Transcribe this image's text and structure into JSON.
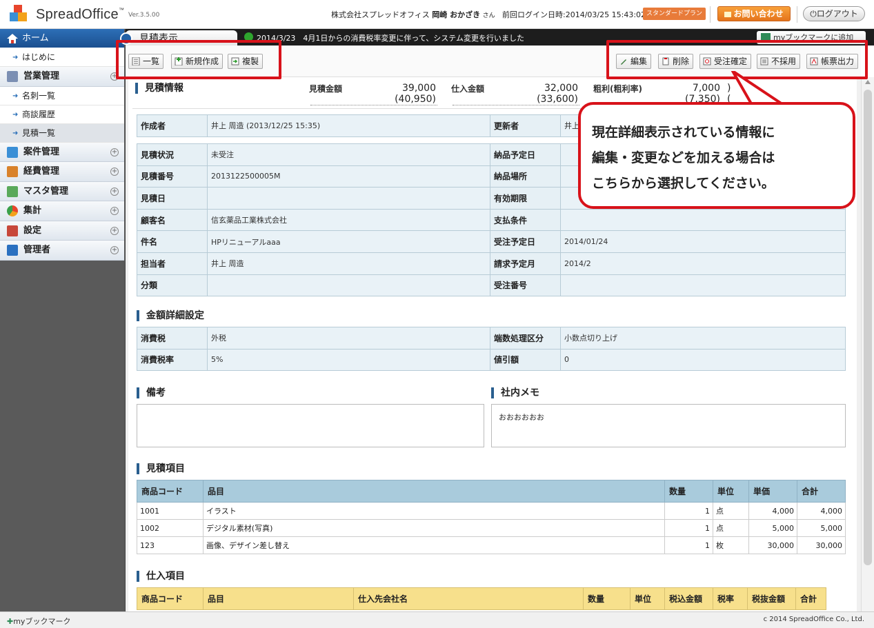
{
  "header": {
    "brand": "SpreadOffice",
    "trademark": "™",
    "version": "Ver.3.5.00",
    "company": "株式会社スプレッドオフィス",
    "user_name": "岡崎 おかざき",
    "honorific": "さん",
    "last_login_label": "前回ログイン日時:",
    "last_login_value": "2014/03/25 15:43:02",
    "plan_badge": "スタンダードプラン",
    "contact_button": "お問い合わせ",
    "logout_button": "ログアウト"
  },
  "sidebar": {
    "home": "ホーム",
    "items": [
      {
        "label": "はじめに",
        "type": "sub"
      },
      {
        "label": "営業管理",
        "type": "section",
        "icon": "sales-icon"
      },
      {
        "label": "名刺一覧",
        "type": "sub"
      },
      {
        "label": "商談履歴",
        "type": "sub"
      },
      {
        "label": "見積一覧",
        "type": "sub",
        "active": true
      },
      {
        "label": "案件管理",
        "type": "section",
        "icon": "project-icon"
      },
      {
        "label": "経費管理",
        "type": "section",
        "icon": "expense-icon"
      },
      {
        "label": "マスタ管理",
        "type": "section",
        "icon": "master-icon"
      },
      {
        "label": "集計",
        "type": "section",
        "icon": "chart-icon"
      },
      {
        "label": "設定",
        "type": "section",
        "icon": "settings-icon"
      },
      {
        "label": "管理者",
        "type": "section",
        "icon": "admin-icon"
      }
    ]
  },
  "notice": {
    "page_tab": "見積表示",
    "text": "2014/3/23　4月1日からの消費税率変更に伴って、システム変更を行いました",
    "bookmark_add": "myブックマークに追加"
  },
  "toolbar": {
    "list": "一覧",
    "new": "新規作成",
    "copy": "複製",
    "edit": "編集",
    "delete": "削除",
    "confirm": "受注確定",
    "reject": "不採用",
    "print": "帳票出力"
  },
  "summary": {
    "title": "見積情報",
    "estimate_label": "見積金額",
    "estimate_value": "39,000",
    "estimate_tax": "(40,950)",
    "purchase_label": "仕入金額",
    "purchase_value": "32,000",
    "purchase_tax": "(33,600)",
    "profit_label": "粗利(粗利率)",
    "profit_value": "7,000",
    "profit_tax": "(7,350)",
    "profit_extra": ")",
    "profit_extra2": "("
  },
  "detail": {
    "creator_label": "作成者",
    "creator_value": "井上 周造 (2013/12/25 15:35)",
    "updater_label": "更新者",
    "updater_value": "井上",
    "rows": [
      {
        "k1": "見積状況",
        "v1": "未受注",
        "k2": "納品予定日",
        "v2": ""
      },
      {
        "k1": "見積番号",
        "v1": "2013122500005M",
        "k2": "納品場所",
        "v2": ""
      },
      {
        "k1": "見積日",
        "v1": "",
        "k2": "有効期限",
        "v2": ""
      },
      {
        "k1": "顧客名",
        "v1": "信玄薬品工業株式会社",
        "k2": "支払条件",
        "v2": ""
      },
      {
        "k1": "件名",
        "v1": "HPリニューアルaaa",
        "k2": "受注予定日",
        "v2": "2014/01/24"
      },
      {
        "k1": "担当者",
        "v1": "井上 周造",
        "k2": "請求予定月",
        "v2": "2014/2"
      },
      {
        "k1": "分類",
        "v1": "",
        "k2": "受注番号",
        "v2": ""
      }
    ]
  },
  "amount": {
    "title": "金額詳細設定",
    "rows": [
      {
        "k1": "消費税",
        "v1": "外税",
        "k2": "端数処理区分",
        "v2": "小数点切り上げ"
      },
      {
        "k1": "消費税率",
        "v1": "5%",
        "k2": "値引額",
        "v2": "0"
      }
    ]
  },
  "memo": {
    "remarks_title": "備考",
    "remarks_value": "",
    "internal_title": "社内メモ",
    "internal_value": "おおおおおお"
  },
  "items": {
    "title": "見積項目",
    "headers": [
      "商品コード",
      "品目",
      "数量",
      "単位",
      "単価",
      "合計"
    ],
    "rows": [
      {
        "code": "1001",
        "name": "イラスト",
        "qty": "1",
        "unit": "点",
        "price": "4,000",
        "total": "4,000"
      },
      {
        "code": "1002",
        "name": "デジタル素材(写真)",
        "qty": "1",
        "unit": "点",
        "price": "5,000",
        "total": "5,000"
      },
      {
        "code": "123",
        "name": "画像、デザイン差し替え",
        "qty": "1",
        "unit": "枚",
        "price": "30,000",
        "total": "30,000"
      }
    ]
  },
  "purchases": {
    "title": "仕入項目",
    "headers": [
      "商品コード",
      "品目",
      "仕入先会社名",
      "数量",
      "単位",
      "税込金額",
      "税率",
      "税抜金額",
      "合計"
    ]
  },
  "callout": {
    "line1": "現在詳細表示されている情報に",
    "line2": "編集・変更などを加える場合は",
    "line3": "こちらから選択してください。"
  },
  "footer": {
    "bookmark": "myブックマーク",
    "copyright": "c 2014 SpreadOffice Co., Ltd."
  },
  "colors": {
    "accent_red": "#d8121a",
    "nav_blue": "#2d6fb7",
    "table_header_blue": "#a9cbdc",
    "table_header_yellow": "#f7e08c",
    "contact_orange": "#f9a13a"
  }
}
